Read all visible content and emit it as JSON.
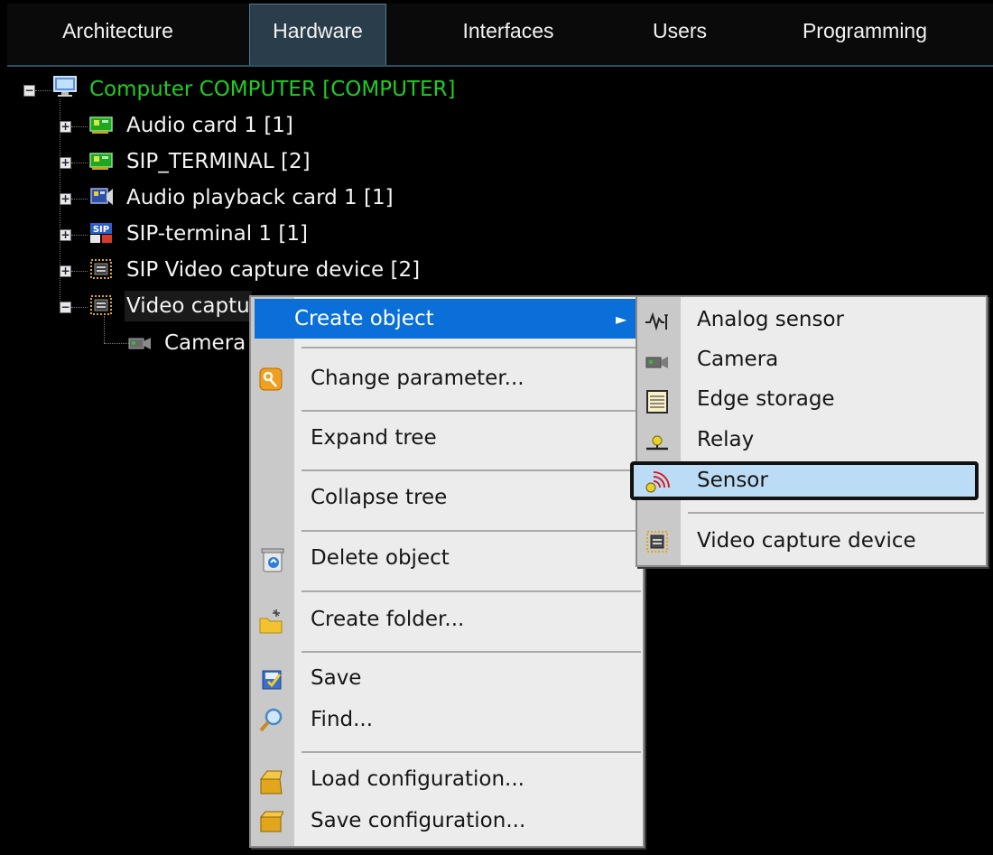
{
  "tabs": [
    {
      "label": "Architecture",
      "active": false
    },
    {
      "label": "Hardware",
      "active": true
    },
    {
      "label": "Interfaces",
      "active": false
    },
    {
      "label": "Users",
      "active": false
    },
    {
      "label": "Programming",
      "active": false
    }
  ],
  "tree": {
    "root": {
      "label": "Computer COMPUTER [COMPUTER]",
      "color": "#22cc22"
    },
    "children": [
      {
        "label": "Audio card 1 [1]",
        "icon": "audio-card-icon"
      },
      {
        "label": "SIP_TERMINAL [2]",
        "icon": "audio-card-icon"
      },
      {
        "label": "Audio playback card 1 [1]",
        "icon": "playback-card-icon"
      },
      {
        "label": "SIP-terminal 1 [1]",
        "icon": "sip-terminal-icon"
      },
      {
        "label": "SIP Video capture device [2]",
        "icon": "video-capture-icon"
      },
      {
        "label": "Video captu",
        "icon": "video-capture-icon"
      }
    ],
    "grandchild": {
      "label": "Camera",
      "icon": "camera-icon"
    }
  },
  "context_menu": {
    "items": [
      {
        "label": "Create object",
        "has_submenu": true
      },
      {
        "label": "Change parameter...",
        "icon": "key-icon"
      },
      {
        "label": "Expand tree"
      },
      {
        "label": "Collapse tree"
      },
      {
        "label": "Delete object",
        "icon": "trash-icon"
      },
      {
        "label": "Create folder...",
        "icon": "new-folder-icon"
      },
      {
        "label": "Save",
        "icon": "save-icon"
      },
      {
        "label": "Find...",
        "icon": "magnifier-icon"
      },
      {
        "label": "Load configuration...",
        "icon": "box-open-icon"
      },
      {
        "label": "Save configuration...",
        "icon": "box-closed-icon"
      }
    ],
    "arrow_glyph": "►"
  },
  "submenu": {
    "items": [
      {
        "label": "Analog sensor",
        "icon": "analog-sensor-icon"
      },
      {
        "label": "Camera",
        "icon": "camera-icon"
      },
      {
        "label": "Edge storage",
        "icon": "edge-storage-icon"
      },
      {
        "label": "Relay",
        "icon": "relay-icon"
      },
      {
        "label": "Sensor",
        "icon": "sensor-icon",
        "highlighted": true
      },
      {
        "label": "Video capture device",
        "icon": "video-capture-icon"
      }
    ]
  },
  "colors": {
    "highlight": "#0a6fd8",
    "submenu_highlight": "#bcdcf5",
    "tree_text": "#f4f4f4"
  }
}
